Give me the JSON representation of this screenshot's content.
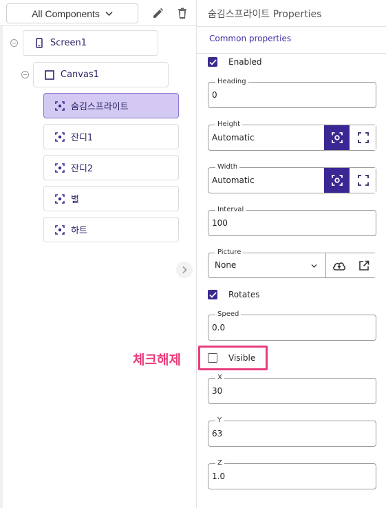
{
  "left_panel": {
    "filter": {
      "label": "All Components"
    },
    "tree": [
      {
        "label": "Screen1"
      },
      {
        "label": "Canvas1"
      },
      {
        "label": "숨김스프라이트"
      },
      {
        "label": "잔디1"
      },
      {
        "label": "잔디2"
      },
      {
        "label": "별"
      },
      {
        "label": "하트"
      }
    ]
  },
  "properties": {
    "title": "숨김스프라이트 Properties",
    "section": "Common properties",
    "enabled": {
      "label": "Enabled",
      "checked": true
    },
    "heading": {
      "label": "Heading",
      "value": "0"
    },
    "height": {
      "label": "Height",
      "value": "Automatic"
    },
    "width": {
      "label": "Width",
      "value": "Automatic"
    },
    "interval": {
      "label": "Interval",
      "value": "100"
    },
    "picture": {
      "label": "Picture",
      "value": "None"
    },
    "rotates": {
      "label": "Rotates",
      "checked": true
    },
    "speed": {
      "label": "Speed",
      "value": "0.0"
    },
    "visible": {
      "label": "Visible",
      "checked": false
    },
    "x": {
      "label": "X",
      "value": "30"
    },
    "y": {
      "label": "Y",
      "value": "63"
    },
    "z": {
      "label": "Z",
      "value": "1.0"
    }
  },
  "annotation": {
    "text": "체크해제",
    "color": "#e93c7e"
  },
  "colors": {
    "accent": "#3a2793",
    "selected_bg": "#d3c9f2",
    "section_title": "#3b2ea3"
  },
  "icons": {
    "edit": "pencil-icon",
    "delete": "trash-icon",
    "dropdown": "chevron-down-icon",
    "screen": "phone-icon",
    "canvas": "square-icon",
    "sprite": "sprite-icon",
    "auto_size": "focus-center-icon",
    "fill_parent": "fullscreen-icon",
    "upload": "cloud-upload-icon",
    "open": "open-external-icon",
    "expand": "chevron-right-icon"
  }
}
